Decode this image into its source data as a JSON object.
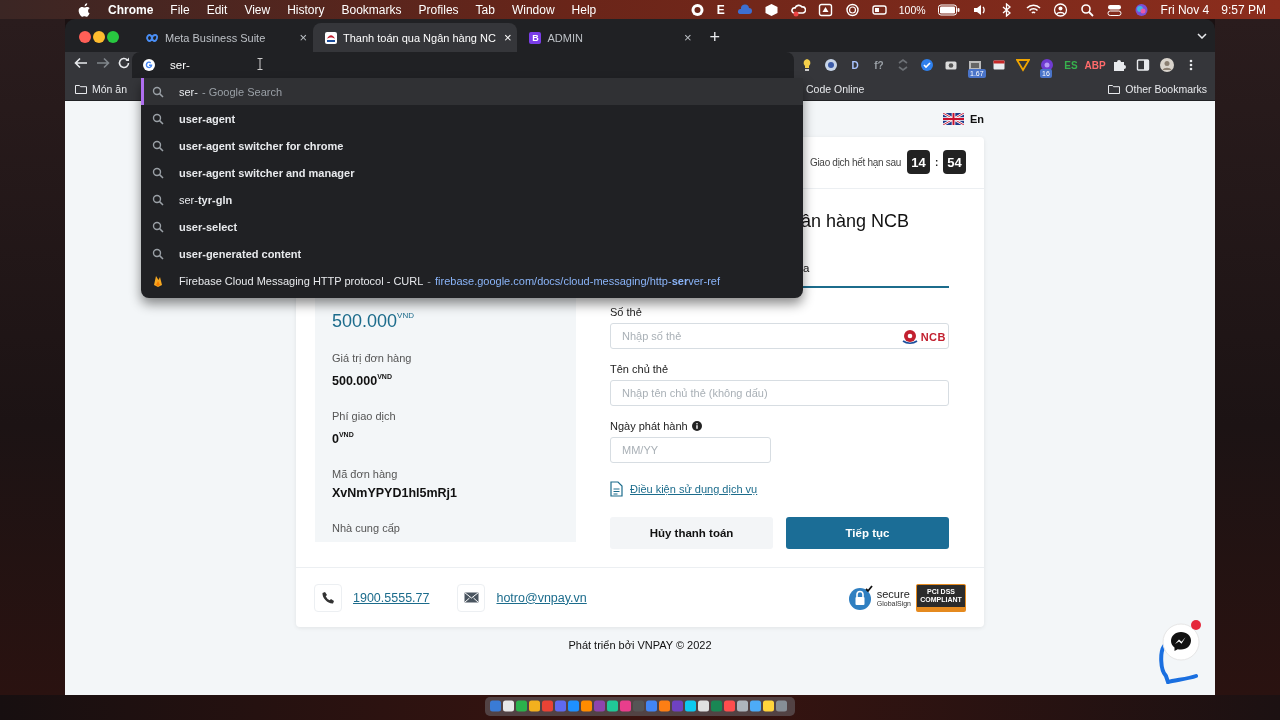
{
  "menu_bar": {
    "app": "Chrome",
    "menus": [
      "File",
      "Edit",
      "View",
      "History",
      "Bookmarks",
      "Profiles",
      "Tab",
      "Window",
      "Help"
    ],
    "status_letter": "E",
    "battery": "100%",
    "date": "Fri Nov 4",
    "time": "9:57 PM"
  },
  "browser": {
    "tabs": [
      {
        "title": "Meta Business Suite",
        "kind": "brand",
        "close": "×",
        "selected": false
      },
      {
        "title": "Thanh toán qua Ngân hàng NC",
        "kind": "site",
        "close": "×",
        "selected": true
      },
      {
        "title": "ADMIN",
        "kind": "letter",
        "icon_text": "B",
        "close": "×",
        "selected": false
      }
    ],
    "new_tab": "+",
    "address_bar": {
      "value": "ser-"
    },
    "extensions": [
      {
        "kind": "icon"
      },
      {
        "kind": "icon"
      },
      {
        "kind": "letter",
        "text": "D",
        "color": "#aac4ff"
      },
      {
        "kind": "letter",
        "text": "f?",
        "color": "#9aa0a6"
      },
      {
        "kind": "icon"
      },
      {
        "kind": "icon"
      },
      {
        "kind": "icon"
      },
      {
        "kind": "badge",
        "text": "1.67"
      },
      {
        "kind": "icon"
      },
      {
        "kind": "icon"
      },
      {
        "kind": "badge",
        "text": "16"
      },
      {
        "kind": "letter",
        "text": "ES",
        "color": "#37b24d"
      },
      {
        "kind": "letter",
        "text": "ABP",
        "color": "#ff6b6b"
      }
    ],
    "bookmarks": [
      "Món ăn",
      "Code Online"
    ],
    "other_bookmarks": "Other Bookmarks",
    "suggestions": [
      {
        "kind": "search",
        "text": "ser-",
        "hint": "- Google Search",
        "bold": false,
        "selected": true
      },
      {
        "kind": "search",
        "text": "user-agent",
        "bold": true,
        "selected": false
      },
      {
        "kind": "search",
        "text": "user-agent switcher for chrome",
        "bold": true,
        "selected": false
      },
      {
        "kind": "search",
        "text": "user-agent switcher and manager",
        "bold": true,
        "selected": false
      },
      {
        "kind": "search",
        "text": "ser-**tyr-gln**",
        "bold": false,
        "selected": false
      },
      {
        "kind": "search",
        "text": "user-select",
        "bold": true,
        "selected": false
      },
      {
        "kind": "search",
        "text": "user-generated content",
        "bold": true,
        "selected": false
      },
      {
        "kind": "history",
        "text": "Firebase Cloud Messaging HTTP protocol -  CURL",
        "separator": "-",
        "url": "firebase.google.com/docs/cloud-messaging/http-**ser**ver-ref",
        "selected": false
      }
    ]
  },
  "page": {
    "language": "En",
    "timer": {
      "label": "Giao dịch hết hạn sau",
      "minutes": "14",
      "separator": ":",
      "seconds": "54"
    },
    "title": "ân hàng NCB",
    "tab": {
      "label": "a",
      "selected": true
    },
    "summary": {
      "amount": "500.000$^{VND}$",
      "rows": [
        {
          "label": "Giá trị đơn hàng",
          "value": "500.000$^{VND}$"
        },
        {
          "label": "Phí giao dịch",
          "value": "0$^{VND}$"
        },
        {
          "label": "Mã đơn hàng",
          "value": "XvNmYPYD1hl5mRj1"
        },
        {
          "label": "Nhà cung cấp"
        }
      ]
    },
    "form": {
      "fields": [
        {
          "kind": "card",
          "label": "Số thẻ",
          "placeholder": "Nhập số thẻ",
          "logo": "NCB"
        },
        {
          "kind": "text",
          "label": "Tên chủ thẻ",
          "placeholder": "Nhập tên chủ thẻ (không dấu)"
        },
        {
          "kind": "date",
          "label": "Ngày phát hành",
          "placeholder": "MM/YY"
        }
      ],
      "terms_link": "Điều kiện sử dụng dịch vụ",
      "buttons": [
        {
          "kind": "secondary",
          "label": "Hủy thanh toán"
        },
        {
          "kind": "primary",
          "label": "Tiếp tục"
        }
      ]
    },
    "contacts": [
      {
        "kind": "phone",
        "text": "1900.5555.77"
      },
      {
        "kind": "email",
        "text": "hotro@vnpay.vn"
      }
    ],
    "secure_badge": {
      "text": "secure",
      "issuer": "GlobalSign"
    },
    "pci_badge": [
      "PCI DSS",
      "COMPLIANT"
    ],
    "footer": "Phát triển bởi VNPAY © 2022"
  }
}
